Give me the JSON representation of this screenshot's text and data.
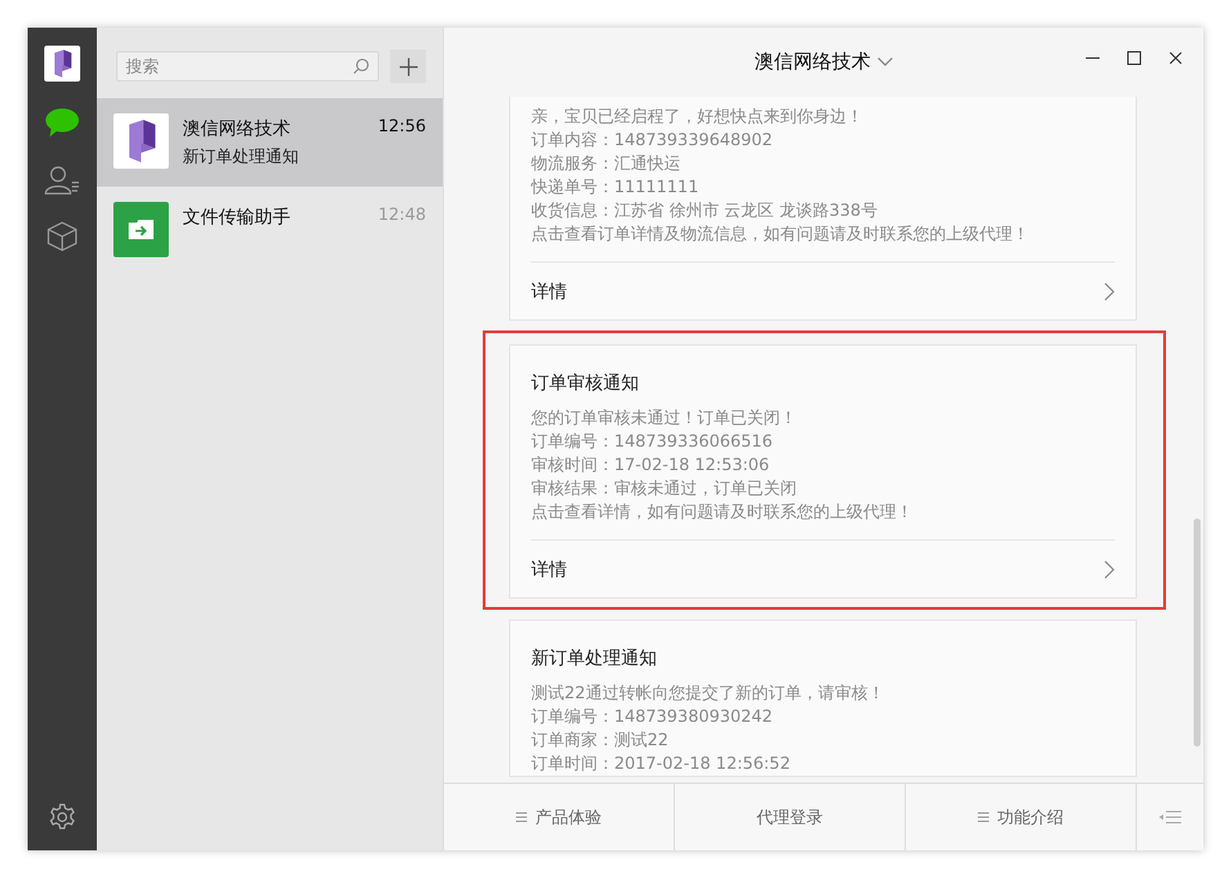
{
  "search": {
    "placeholder": "搜索"
  },
  "chats": [
    {
      "name": "澳信网络技术",
      "preview": "新订单处理通知",
      "time": "12:56",
      "kind": "brand",
      "selected": true
    },
    {
      "name": "文件传输助手",
      "time": "12:48",
      "kind": "file",
      "selected": false
    }
  ],
  "header": {
    "title": "澳信网络技术"
  },
  "messages": [
    {
      "lines": [
        "亲，宝贝已经启程了，好想快点来到你身边！",
        "订单内容：148739339648902",
        "物流服务：汇通快运",
        "快递单号：11111111",
        "收货信息：江苏省 徐州市 云龙区 龙谈路338号",
        "点击查看订单详情及物流信息，如有问题请及时联系您的上级代理！"
      ],
      "link": "详情",
      "highlighted": false
    },
    {
      "title": "订单审核通知",
      "lines": [
        "您的订单审核未通过！订单已关闭！",
        "订单编号：148739336066516",
        "审核时间：17-02-18 12:53:06",
        "审核结果：审核未通过，订单已关闭",
        "点击查看详情，如有问题请及时联系您的上级代理！"
      ],
      "link": "详情",
      "highlighted": true
    },
    {
      "title": "新订单处理通知",
      "lines": [
        "测试22通过转帐向您提交了新的订单，请审核！",
        "订单编号：148739380930242",
        "订单商家：测试22",
        "订单时间：2017-02-18 12:56:52"
      ],
      "highlighted": false
    }
  ],
  "menu": [
    {
      "label": "产品体验",
      "submenu": true
    },
    {
      "label": "代理登录",
      "submenu": false
    },
    {
      "label": "功能介绍",
      "submenu": true
    }
  ]
}
